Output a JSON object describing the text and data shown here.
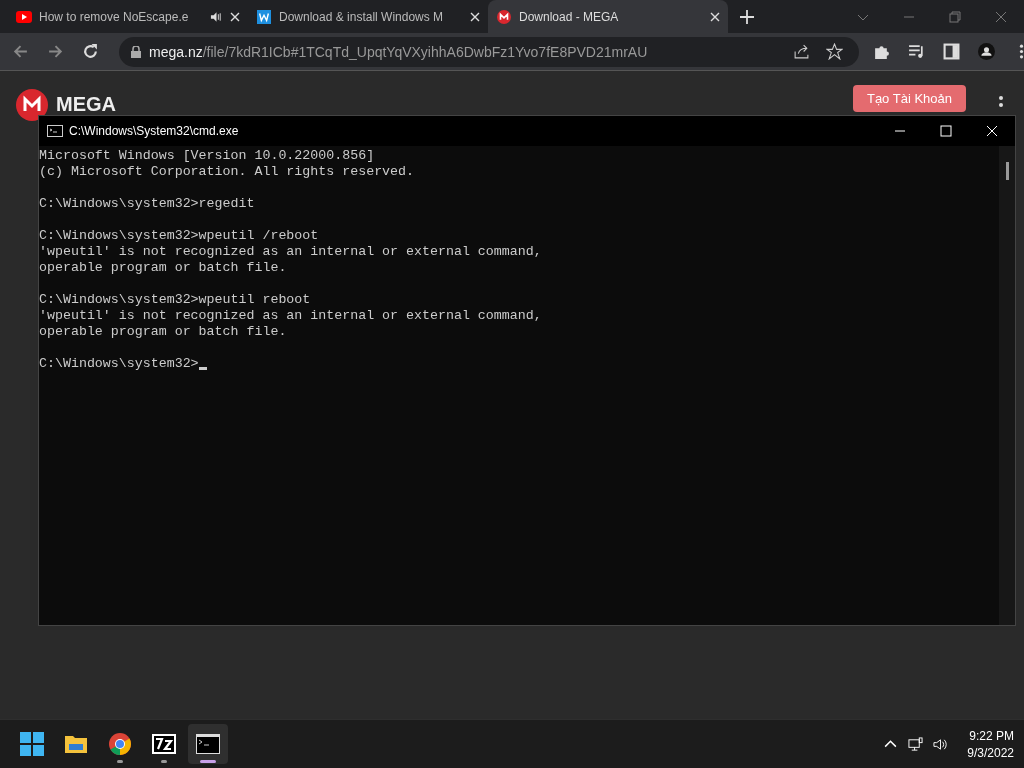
{
  "tabs": [
    {
      "title": "How to remove NoEscape.e",
      "kind": "youtube",
      "audio": true,
      "selected": false
    },
    {
      "title": "Download & install Windows M",
      "kind": "word",
      "audio": false,
      "selected": false
    },
    {
      "title": "Download - MEGA",
      "kind": "mega",
      "audio": false,
      "selected": true
    }
  ],
  "address": {
    "host": "mega.nz",
    "path": "/file/7kdR1ICb#1TCqTd_UpqtYqVXyihhA6DwbFz1Yvo7fE8PVD21mrAU"
  },
  "page": {
    "logo_text": "MEGA",
    "button": "Tạo Tài Khoản"
  },
  "console": {
    "title": "C:\\Windows\\System32\\cmd.exe",
    "blocks": [
      [
        "Microsoft Windows [Version 10.0.22000.856]",
        "(c) Microsoft Corporation. All rights reserved."
      ],
      [
        "C:\\Windows\\system32>regedit"
      ],
      [
        "C:\\Windows\\system32>wpeutil /reboot",
        "'wpeutil' is not recognized as an internal or external command,",
        "operable program or batch file."
      ],
      [
        "C:\\Windows\\system32>wpeutil reboot",
        "'wpeutil' is not recognized as an internal or external command,",
        "operable program or batch file."
      ],
      [
        "C:\\Windows\\system32>"
      ]
    ]
  },
  "taskbar": {
    "apps": [
      {
        "kind": "start",
        "running": false,
        "selected": false
      },
      {
        "kind": "folder",
        "running": false,
        "selected": false
      },
      {
        "kind": "chrome",
        "running": true,
        "selected": false
      },
      {
        "kind": "archive",
        "running": true,
        "selected": false
      },
      {
        "kind": "cmd",
        "running": true,
        "selected": true
      }
    ],
    "time": "9:22 PM",
    "date": "9/3/2022"
  }
}
